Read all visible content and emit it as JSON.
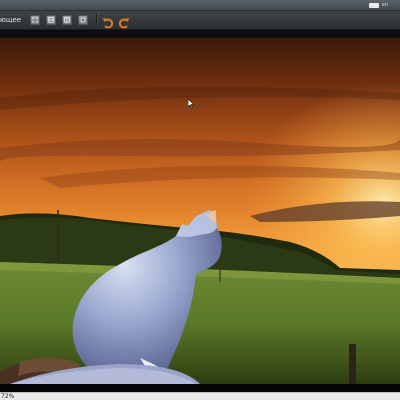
{
  "toolbar": {
    "label": "ющее",
    "buttons": [
      {
        "icon": "fit-window-icon"
      },
      {
        "icon": "actual-size-icon"
      },
      {
        "icon": "fit-width-icon"
      },
      {
        "icon": "fullscreen-icon"
      }
    ],
    "rotate_left_icon": "rotate-left-icon",
    "rotate_right_icon": "rotate-right-icon"
  },
  "sysbar": {
    "layout_label": "en"
  },
  "status": {
    "zoom": "72%"
  },
  "colors": {
    "toolbar_bg": "#2f3336",
    "rotate_icon": "#e07a1f",
    "sky_top": "#3a1b0c",
    "sky_glow": "#f7a23a",
    "grass": "#5c7a2a"
  }
}
